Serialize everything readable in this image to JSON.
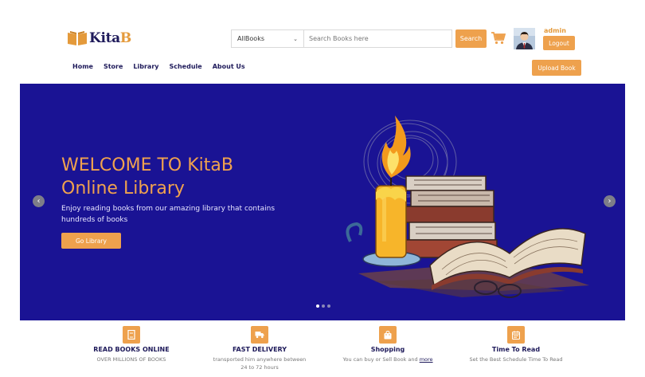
{
  "header": {
    "logo_text_main": "Kita",
    "logo_text_accent": "B",
    "search": {
      "category_selected": "AllBooks",
      "placeholder": "Search Books here",
      "button_label": "Search"
    },
    "user": {
      "name": "admin",
      "logout_label": "Logout"
    },
    "upload_label": "Upload Book"
  },
  "nav": {
    "items": [
      {
        "label": "Home"
      },
      {
        "label": "Store"
      },
      {
        "label": "Library"
      },
      {
        "label": "Schedule"
      },
      {
        "label": "About Us"
      }
    ]
  },
  "hero": {
    "title_line1": "WELCOME TO KitaB",
    "title_line2": "Online Library",
    "subtitle": "Enjoy reading books from our amazing library that contains hundreds of books",
    "button_label": "Go Library",
    "slides_count": 3,
    "active_slide": 1
  },
  "features": [
    {
      "icon": "book-icon",
      "title": "READ BOOKS ONLINE",
      "desc": "OVER MILLIONS OF BOOKS"
    },
    {
      "icon": "truck-icon",
      "title": "FAST DELIVERY",
      "desc": "transported him anywhere between 24 to 72 hours"
    },
    {
      "icon": "shopping-bag-icon",
      "title": "Shopping",
      "desc": "You can buy or Sell Book and",
      "link": "more"
    },
    {
      "icon": "calendar-icon",
      "title": "Time To Read",
      "desc": "Set the Best Schedule Time To Read"
    }
  ],
  "colors": {
    "accent": "#eea14d",
    "navy": "#1e1a5a",
    "hero_bg": "#1a1394"
  }
}
